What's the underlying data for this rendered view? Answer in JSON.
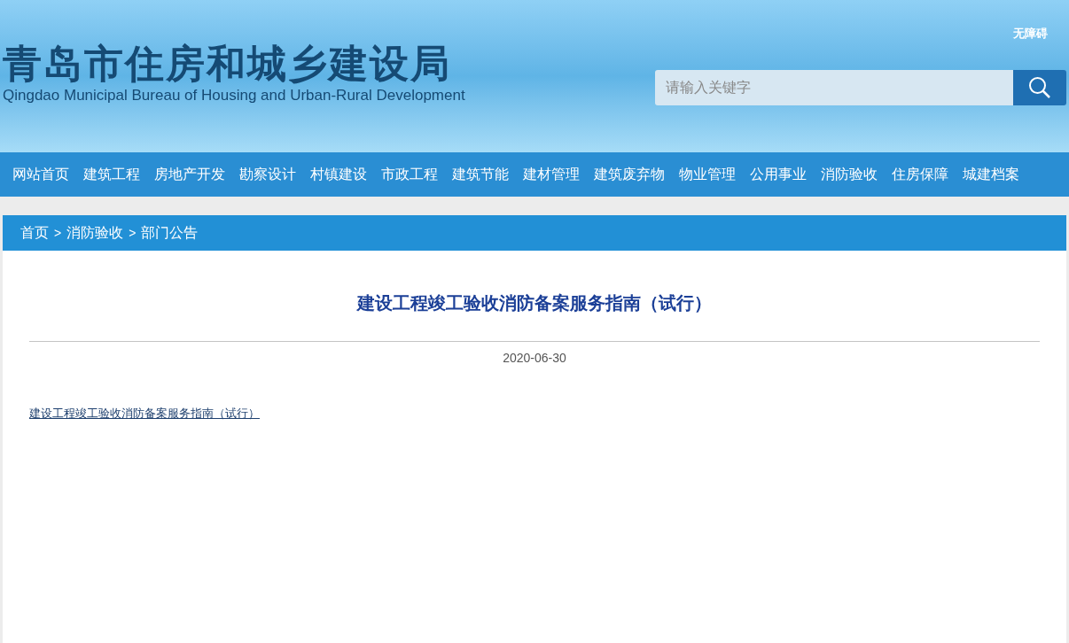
{
  "header": {
    "title": "青岛市住房和城乡建设局",
    "subtitle": "Qingdao Municipal Bureau of Housing and Urban-Rural Development",
    "accessibility_link": "无障碍",
    "search": {
      "placeholder": "请输入关键字"
    }
  },
  "nav": {
    "items": [
      {
        "label": "网站首页",
        "selected": false
      },
      {
        "label": "建筑工程",
        "selected": false
      },
      {
        "label": "房地产开发",
        "selected": false
      },
      {
        "label": "勘察设计",
        "selected": false
      },
      {
        "label": "村镇建设",
        "selected": false
      },
      {
        "label": "市政工程",
        "selected": false
      },
      {
        "label": "建筑节能",
        "selected": false
      },
      {
        "label": "建材管理",
        "selected": false
      },
      {
        "label": "建筑废弃物",
        "selected": false
      },
      {
        "label": "物业管理",
        "selected": false
      },
      {
        "label": "公用事业",
        "selected": false
      },
      {
        "label": "消防验收",
        "selected": false
      },
      {
        "label": "住房保障",
        "selected": false
      },
      {
        "label": "城建档案",
        "selected": false
      }
    ]
  },
  "breadcrumb": {
    "separator": ">",
    "items": [
      "首页",
      "消防验收",
      "部门公告"
    ]
  },
  "article": {
    "title": "建设工程竣工验收消防备案服务指南（试行）",
    "date": "2020-06-30",
    "attachment_link": "建设工程竣工验收消防备案服务指南（试行）"
  }
}
